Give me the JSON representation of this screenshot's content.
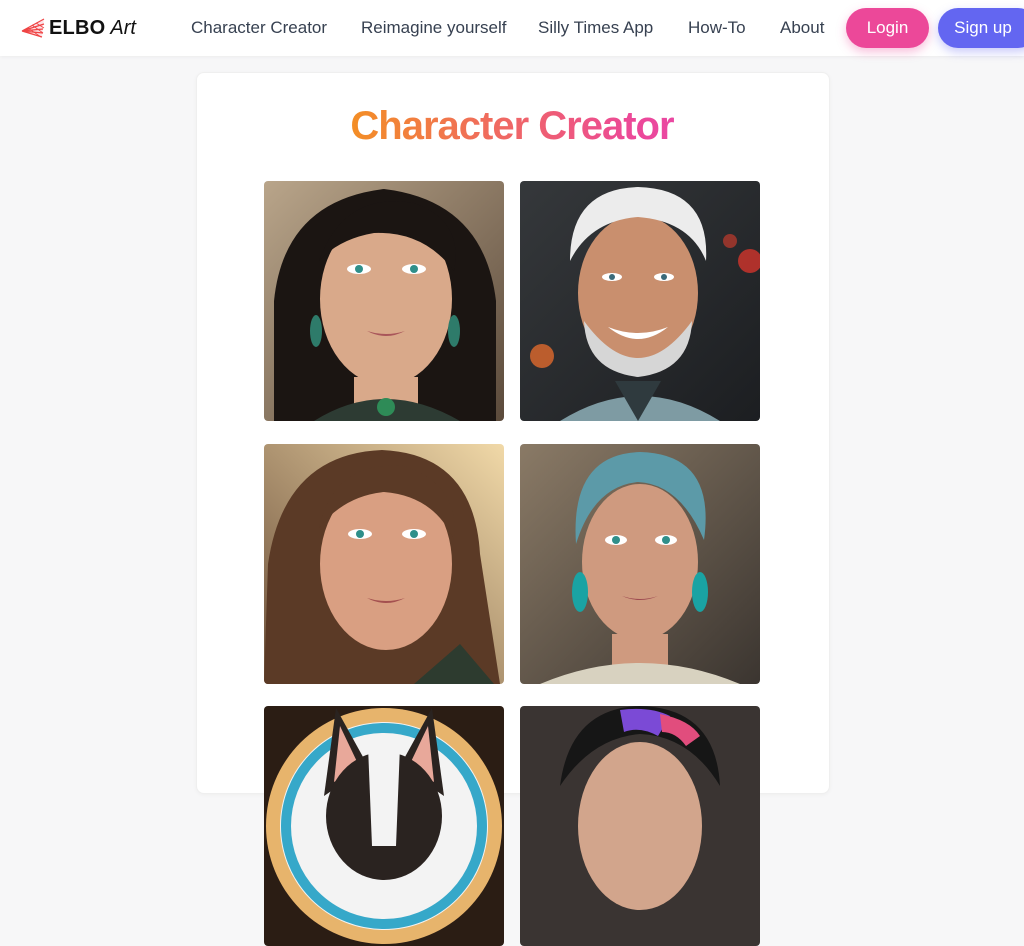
{
  "brand": {
    "name": "ELBO",
    "suffix": "Art"
  },
  "nav": {
    "links": [
      "Character Creator",
      "Reimagine yourself",
      "Silly Times App",
      "How-To",
      "About"
    ],
    "login": "Login",
    "signup": "Sign up"
  },
  "page": {
    "title": "Character Creator"
  },
  "gallery": [
    {
      "name": "portrait-woman-dark-hair"
    },
    {
      "name": "portrait-man-white-hair"
    },
    {
      "name": "portrait-woman-brown-hair"
    },
    {
      "name": "portrait-woman-blue-hair"
    },
    {
      "name": "portrait-dog"
    },
    {
      "name": "portrait-man-colorful-hair"
    }
  ],
  "colors": {
    "login": "#ec4899",
    "signup": "#6366f1",
    "title_start": "#fcd34d",
    "title_end": "#d946ef"
  }
}
